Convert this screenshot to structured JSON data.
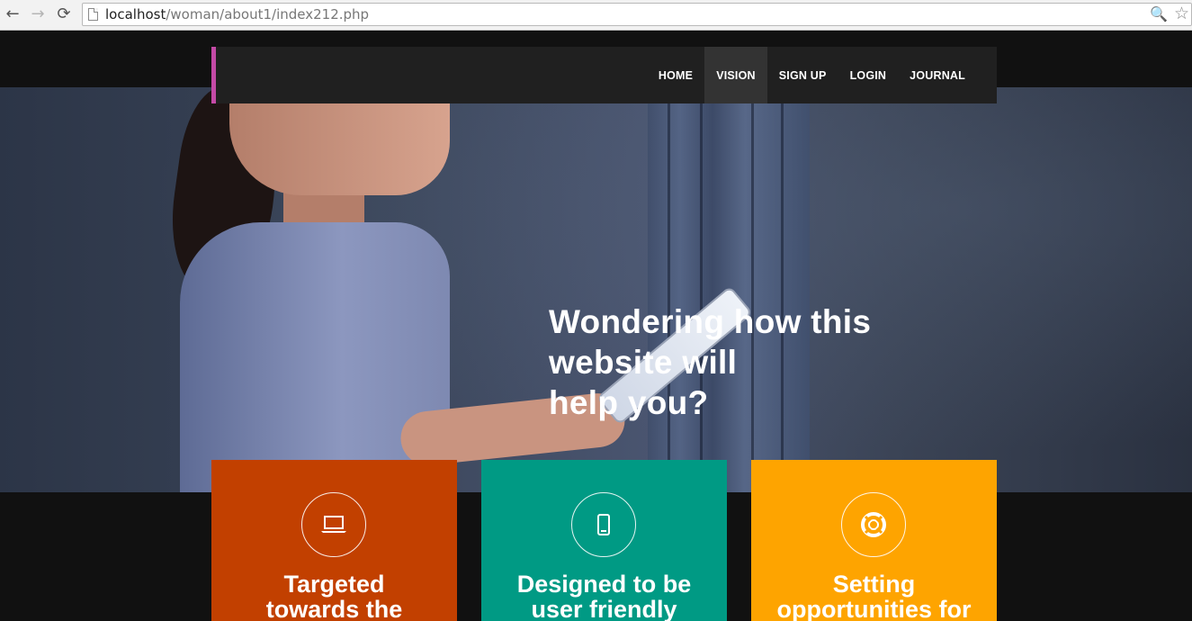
{
  "browser": {
    "back_icon": "←",
    "forward_icon": "→",
    "reload_icon": "⟳",
    "url_host": "localhost",
    "url_path": "/woman/about1/index212.php",
    "zoom_icon": "🔍",
    "star_icon": "☆"
  },
  "nav": {
    "items": [
      {
        "label": "HOME",
        "active": false
      },
      {
        "label": "VISION",
        "active": true
      },
      {
        "label": "SIGN UP",
        "active": false
      },
      {
        "label": "LOGIN",
        "active": false
      },
      {
        "label": "JOURNAL",
        "active": false
      }
    ],
    "accent_color": "#c44aa6"
  },
  "hero": {
    "title_line1": "Wondering how this",
    "title_line2": "website will",
    "title_line3": "help you?"
  },
  "cards": [
    {
      "icon": "laptop-icon",
      "title_line1": "Targeted",
      "title_line2": "towards the",
      "color": "#c24000"
    },
    {
      "icon": "mobile-icon",
      "title_line1": "Designed to be",
      "title_line2": "user friendly",
      "color": "#009a84"
    },
    {
      "icon": "lifebuoy-icon",
      "title_line1": "Setting",
      "title_line2": "opportunities for",
      "color": "#fea400"
    }
  ]
}
